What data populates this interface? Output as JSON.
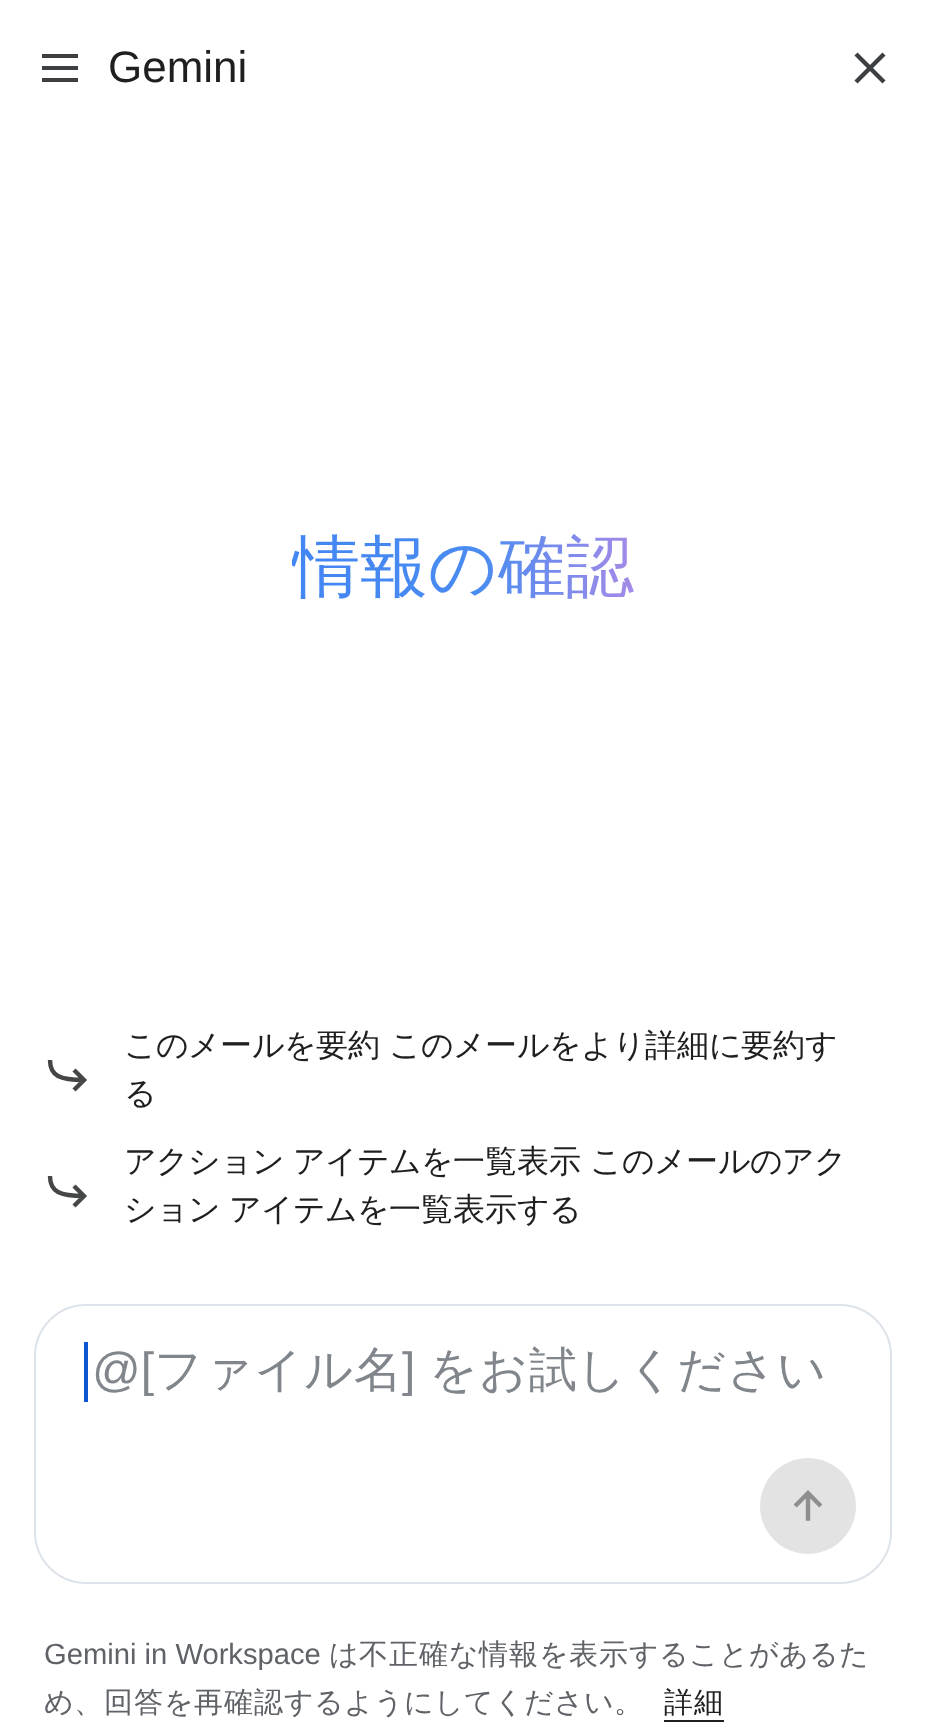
{
  "header": {
    "title": "Gemini"
  },
  "heading": "情報の確認",
  "suggestions": [
    {
      "text": "このメールを要約 このメールをより詳細に要約する"
    },
    {
      "text": "アクション アイテムを一覧表示 このメールのアクション アイテムを一覧表示する"
    }
  ],
  "prompt": {
    "placeholder": "@[ファイル名] をお試しください",
    "send_disabled": true
  },
  "footer": {
    "notice": "Gemini in Workspace は不正確な情報を表示することがあるため、回答を再確認するようにしてください。",
    "link": "詳細"
  }
}
